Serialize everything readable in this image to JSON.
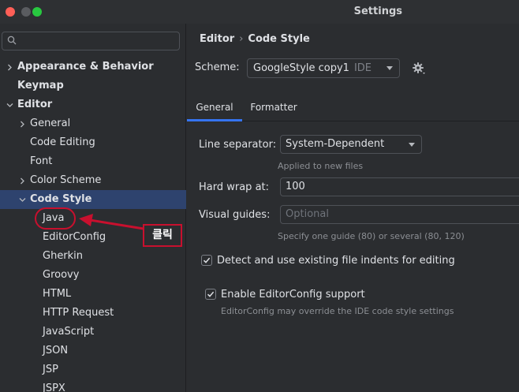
{
  "window": {
    "title": "Settings"
  },
  "search": {
    "placeholder": ""
  },
  "tree": [
    {
      "label": "Appearance & Behavior",
      "bold": true,
      "chevron": "right",
      "indent": 0
    },
    {
      "label": "Keymap",
      "bold": true,
      "chevron": "none",
      "indent": 0
    },
    {
      "label": "Editor",
      "bold": true,
      "chevron": "down",
      "indent": 0
    },
    {
      "label": "General",
      "bold": false,
      "chevron": "right",
      "indent": 1
    },
    {
      "label": "Code Editing",
      "bold": false,
      "chevron": "none",
      "indent": 1
    },
    {
      "label": "Font",
      "bold": false,
      "chevron": "none",
      "indent": 1
    },
    {
      "label": "Color Scheme",
      "bold": false,
      "chevron": "right",
      "indent": 1
    },
    {
      "label": "Code Style",
      "bold": true,
      "chevron": "down",
      "indent": 1,
      "selected": true
    },
    {
      "label": "Java",
      "bold": false,
      "chevron": "none",
      "indent": 2
    },
    {
      "label": "EditorConfig",
      "bold": false,
      "chevron": "none",
      "indent": 2
    },
    {
      "label": "Gherkin",
      "bold": false,
      "chevron": "none",
      "indent": 2
    },
    {
      "label": "Groovy",
      "bold": false,
      "chevron": "none",
      "indent": 2
    },
    {
      "label": "HTML",
      "bold": false,
      "chevron": "none",
      "indent": 2
    },
    {
      "label": "HTTP Request",
      "bold": false,
      "chevron": "none",
      "indent": 2
    },
    {
      "label": "JavaScript",
      "bold": false,
      "chevron": "none",
      "indent": 2
    },
    {
      "label": "JSON",
      "bold": false,
      "chevron": "none",
      "indent": 2
    },
    {
      "label": "JSP",
      "bold": false,
      "chevron": "none",
      "indent": 2
    },
    {
      "label": "JSPX",
      "bold": false,
      "chevron": "none",
      "indent": 2
    }
  ],
  "annotation": {
    "label": "클릭",
    "color": "#c8102e"
  },
  "breadcrumb": {
    "parent": "Editor",
    "separator": "›",
    "current": "Code Style"
  },
  "scheme": {
    "label": "Scheme:",
    "value": "GoogleStyle copy1",
    "suffix": "IDE"
  },
  "tabs": [
    {
      "label": "General",
      "active": true
    },
    {
      "label": "Formatter",
      "active": false
    }
  ],
  "general": {
    "line_separator": {
      "label": "Line separator:",
      "value": "System-Dependent",
      "hint": "Applied to new files"
    },
    "hard_wrap": {
      "label": "Hard wrap at:",
      "value": "100"
    },
    "visual_guides": {
      "label": "Visual guides:",
      "placeholder": "Optional",
      "hint": "Specify one guide (80) or several (80, 120)"
    },
    "detect_indents": {
      "label": "Detect and use existing file indents for editing",
      "checked": true
    },
    "editorconfig": {
      "label": "Enable EditorConfig support",
      "checked": true,
      "hint": "EditorConfig may override the IDE code style settings"
    }
  },
  "colors": {
    "accent": "#3574f0",
    "selection": "#2e436e",
    "background": "#2b2d30"
  }
}
